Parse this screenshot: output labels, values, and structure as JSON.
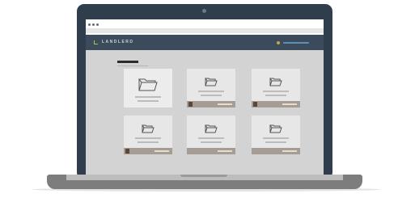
{
  "app": {
    "brand": "LANDLERD"
  },
  "page": {
    "folder_cards": 6,
    "selected_card": 1
  },
  "colors": {
    "lid": "#2f3d4c",
    "header": "#3b4b5c",
    "accent": "#9cc94b",
    "card": "#e7e7e7",
    "footer": "#a49c95",
    "swatch": "#5a4737"
  }
}
